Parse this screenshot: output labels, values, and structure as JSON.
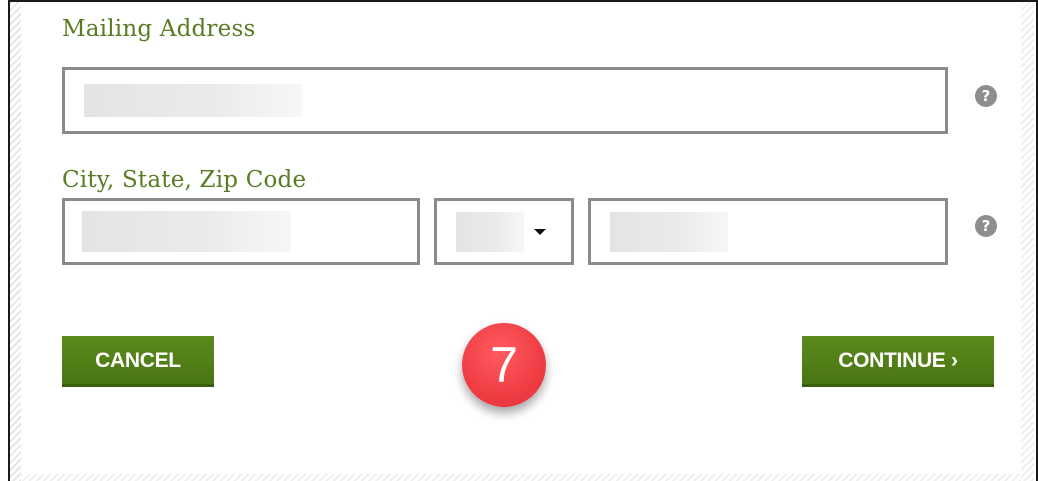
{
  "form": {
    "mailing_address_label": "Mailing Address",
    "city_state_zip_label": "City, State, Zip Code",
    "help_glyph": "?",
    "state_dropdown_icon": "caret-down-icon"
  },
  "buttons": {
    "cancel_label": "CANCEL",
    "continue_label": "CONTINUE ›"
  },
  "annotation": {
    "step_number": "7"
  },
  "colors": {
    "label_green": "#5a7a24",
    "button_green": "#527f18",
    "field_border": "#8a8a8a",
    "badge_red": "#f03d44"
  }
}
